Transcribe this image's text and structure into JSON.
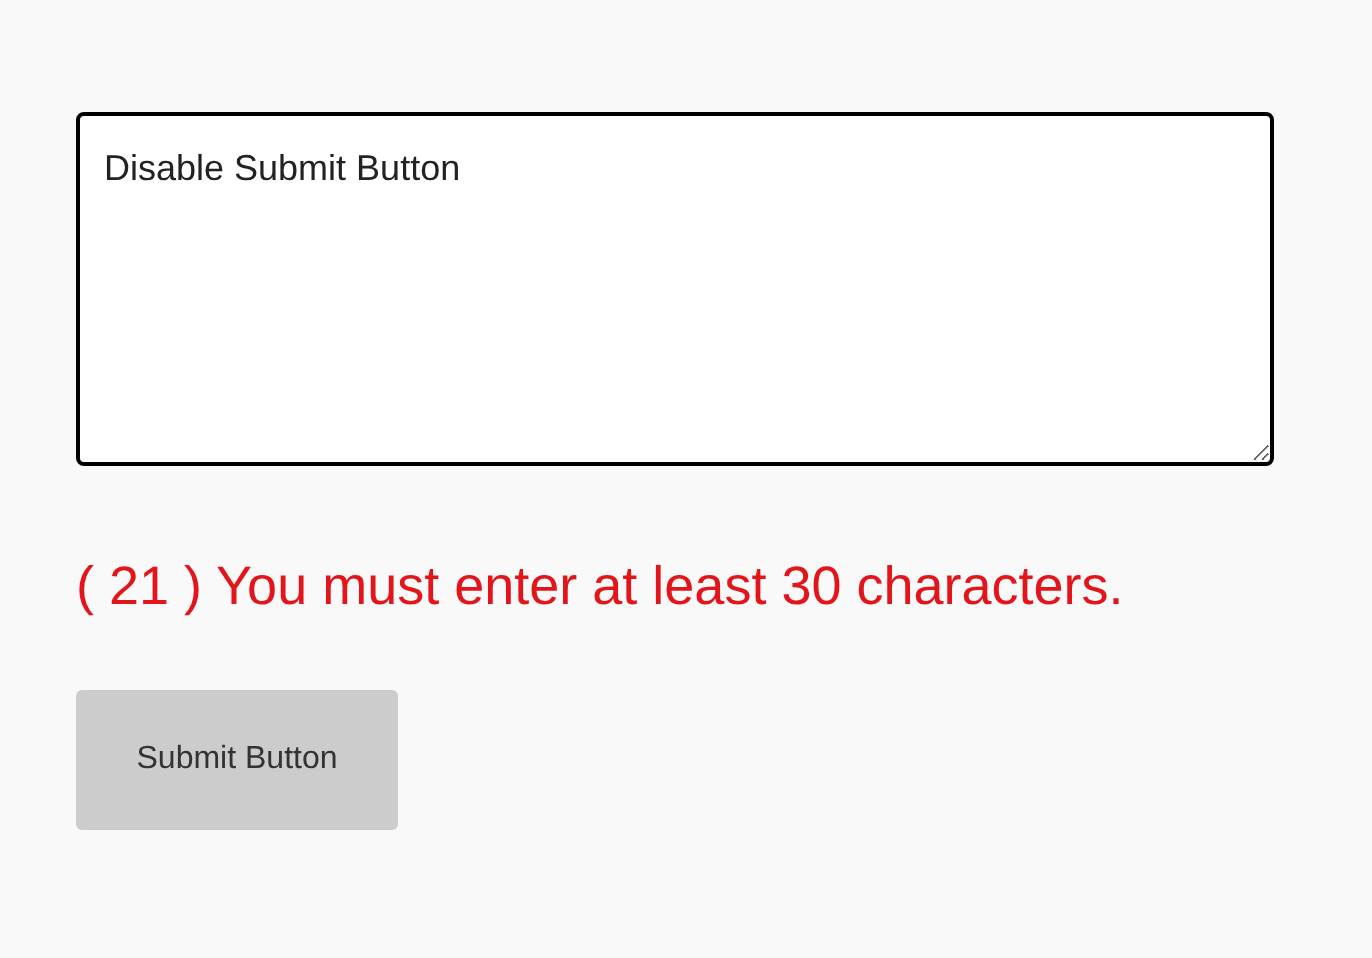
{
  "textarea": {
    "value": "Disable Submit Button"
  },
  "message": {
    "text": "( 21 ) You must enter at least 30 characters."
  },
  "button": {
    "label": "Submit Button",
    "disabled": true
  }
}
